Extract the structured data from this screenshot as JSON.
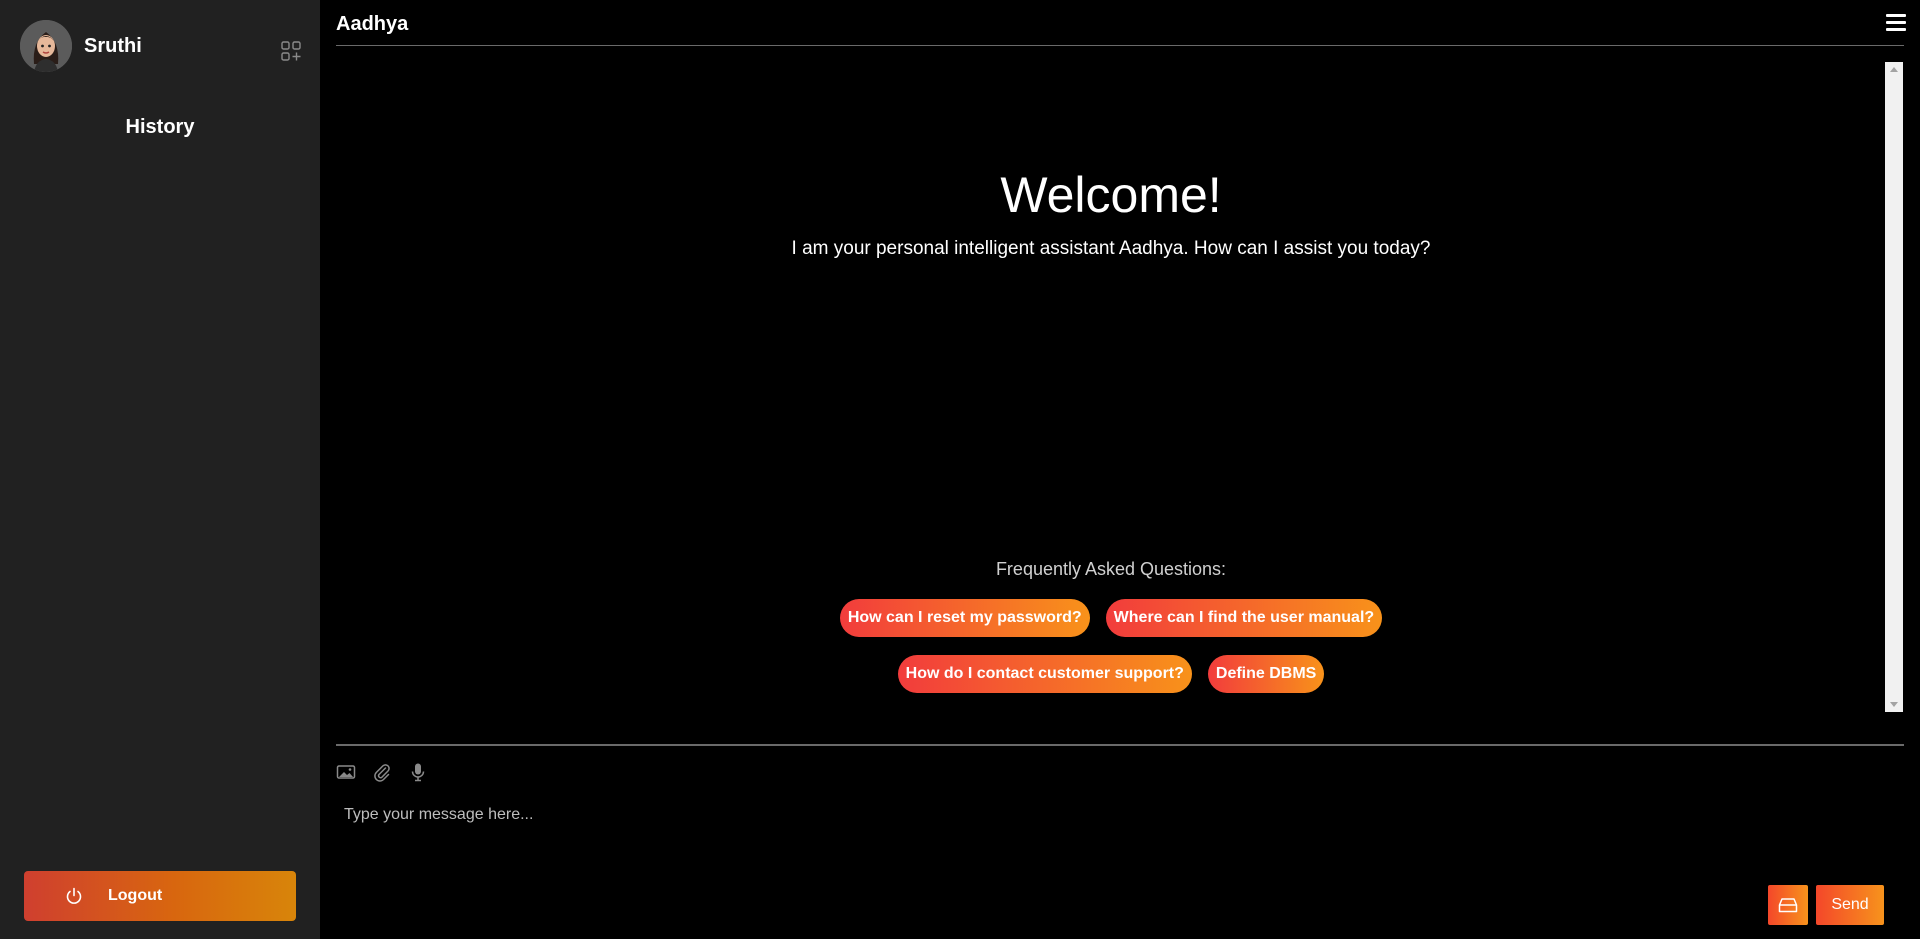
{
  "sidebar": {
    "username": "Sruthi",
    "history_title": "History",
    "logout_label": "Logout",
    "new_chat_icon": "grid-plus-icon",
    "logout_icon": "power-icon"
  },
  "header": {
    "title": "Aadhya",
    "menu_icon": "hamburger-icon"
  },
  "chat": {
    "welcome": "Welcome!",
    "intro": "I am your personal intelligent assistant Aadhya. How can I assist you today?",
    "faq_title": "Frequently Asked Questions:",
    "faq": [
      "How can I reset my password?",
      "Where can I find the user manual?",
      "How do I contact customer support?",
      "Define DBMS"
    ]
  },
  "composer": {
    "tools": [
      "image-icon",
      "paperclip-icon",
      "microphone-icon"
    ],
    "placeholder": "Type your message here...",
    "value": "",
    "save_icon": "archive-icon",
    "send_label": "Send"
  },
  "colors": {
    "sidebar_bg": "#212121",
    "main_bg": "#000000",
    "accent_start": "#f23c3c",
    "accent_end": "#f8921a"
  }
}
